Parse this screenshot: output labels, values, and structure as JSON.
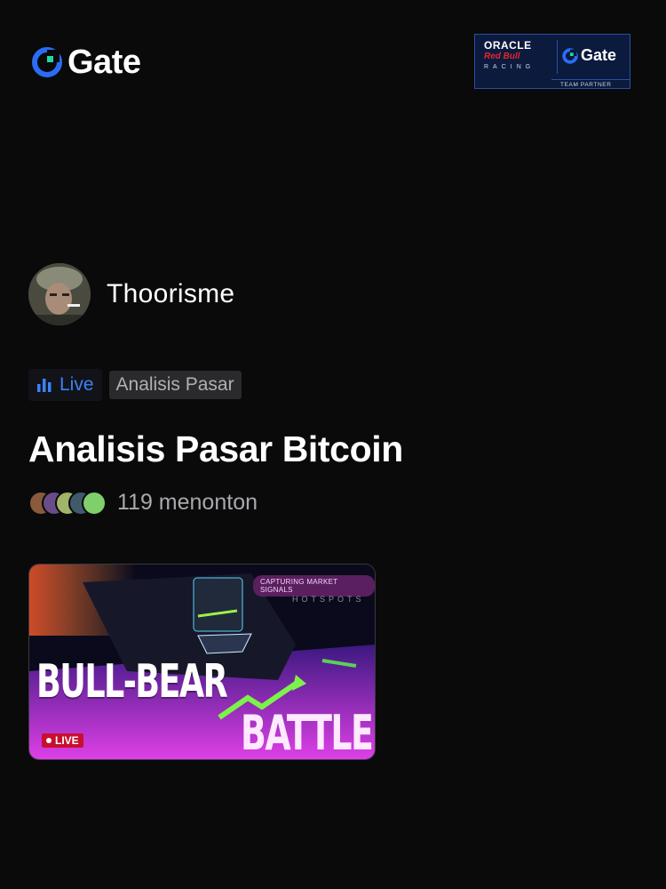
{
  "header": {
    "logo_text": "Gate",
    "partner": {
      "oracle": "ORACLE",
      "redbull": "Red Bull",
      "racing": "RACING",
      "gate_text": "Gate",
      "team_partner": "TEAM PARTNER"
    }
  },
  "host": {
    "name": "Thoorisme"
  },
  "tags": {
    "live_label": "Live",
    "category": "Analisis Pasar"
  },
  "stream": {
    "title": "Analisis Pasar Bitcoin",
    "viewers_text": "119 menonton"
  },
  "thumbnail": {
    "banner": "CAPTURING MARKET SIGNALS",
    "sub_banner": "HOTSPOTS",
    "headline_1": "BULL-BEAR",
    "headline_2": "BATTLE",
    "live_badge": "LIVE"
  },
  "colors": {
    "accent_blue": "#3b82f6",
    "background": "#0a0a0b",
    "live_red": "#c8102e"
  }
}
